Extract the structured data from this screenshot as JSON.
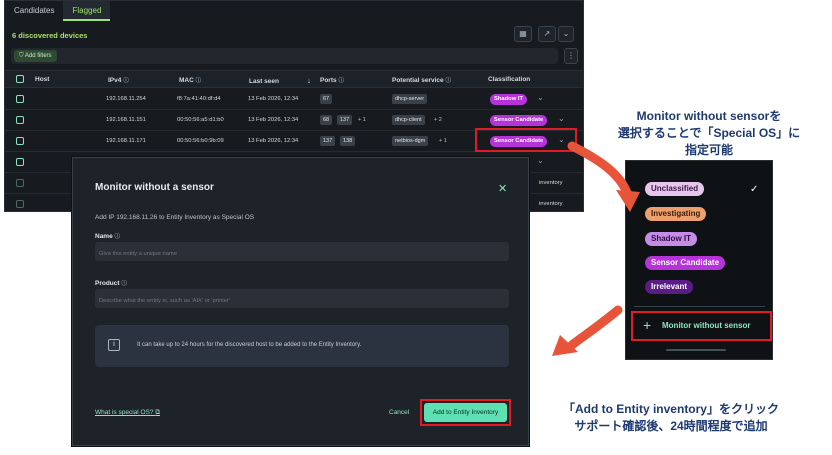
{
  "app": {
    "tabs": [
      {
        "label": "Candidates"
      },
      {
        "label": "Flagged"
      }
    ],
    "device_count": "6 discovered devices",
    "add_filters": "Add filters",
    "columns": [
      "Host",
      "IPv4",
      "MAC",
      "Last seen",
      "Ports",
      "Potential service",
      "Classification"
    ],
    "rows": [
      {
        "ipv4": "192.168.11.254",
        "mac": "f8:7a:41:40:df:d4",
        "last_seen": "13 Feb 2026, 12:34",
        "ports": [
          "67"
        ],
        "ports_more": "",
        "service": "dhcp-server",
        "service_more": "",
        "classification": "Shadow IT"
      },
      {
        "ipv4": "192.168.11.151",
        "mac": "00:50:56:a5:d1:b0",
        "last_seen": "13 Feb 2026, 12:34",
        "ports": [
          "68",
          "137"
        ],
        "ports_more": "+ 1",
        "service": "dhcp-client",
        "service_more": "+ 2",
        "classification": "Sensor Candidate"
      },
      {
        "ipv4": "192.168.11.171",
        "mac": "00:50:56:b0:9b:09",
        "last_seen": "13 Feb 2026, 12:34",
        "ports": [
          "137",
          "138"
        ],
        "ports_more": "",
        "service": "netbios-dgm",
        "service_more": "+ 1",
        "classification": "Sensor Candidate"
      }
    ],
    "right_overflow": [
      "inventory",
      "inventory"
    ]
  },
  "modal": {
    "title": "Monitor without a sensor",
    "description": "Add IP 192.168.11.26 to Entity Inventory as Special OS",
    "name_label": "Name",
    "name_placeholder": "Give this entity a unique name",
    "product_label": "Product",
    "product_placeholder": "Describe what the entity is, such as 'AIX' or 'printer'",
    "info_text": "It can take up to 24 hours for the discovered host to be added to the Entity Inventory.",
    "special_os_link": "What is special OS?",
    "cancel": "Cancel",
    "add_button": "Add to Entity Inventory"
  },
  "dropdown": {
    "options": [
      {
        "label": "Unclassified",
        "bg": "#e7c6ee",
        "fg": "#3a1b45"
      },
      {
        "label": "Investigating",
        "bg": "#ee9f6e",
        "fg": "#3a1d0a"
      },
      {
        "label": "Shadow IT",
        "bg": "#c48ce6",
        "fg": "#2e1040"
      },
      {
        "label": "Sensor Candidate",
        "bg": "#b632d9",
        "fg": "#ffffff"
      },
      {
        "label": "Irrelevant",
        "bg": "#5a1d86",
        "fg": "#ffffff"
      }
    ],
    "action": "Monitor without sensor"
  },
  "annotations": {
    "top_lines": [
      "Monitor without sensorを",
      "選択することで「Special OS」に",
      "指定可能"
    ],
    "bottom_lines": [
      "「Add to Entity inventory」をクリック",
      "サポート確認後、24時間程度で追加"
    ]
  },
  "colors": {
    "accent_green": "#8fe3bd",
    "badge_purple": "#b632d9",
    "highlight_red": "#e01b24",
    "annotation_blue": "#1f3a70",
    "arrow": "#e8543a"
  }
}
